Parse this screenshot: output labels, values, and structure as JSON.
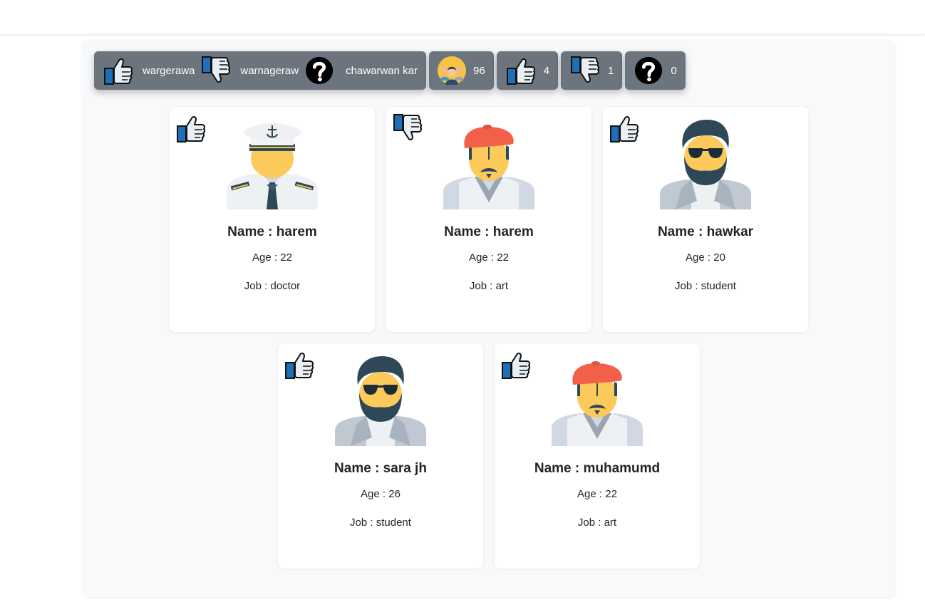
{
  "toolbar": {
    "legend": {
      "like_label": "wargerawa",
      "dislike_label": "warnageraw",
      "unknown_label": "chawarwan kar"
    },
    "counters": {
      "total": "96",
      "likes": "4",
      "dislikes": "1",
      "unknown": "0"
    }
  },
  "cards": [
    {
      "name": "Name : harem",
      "age": "Age : 22",
      "job": "Job : doctor",
      "vote": "thumbs-up",
      "avatar": "captain"
    },
    {
      "name": "Name : harem",
      "age": "Age : 22",
      "job": "Job : art",
      "vote": "thumbs-down",
      "avatar": "beret"
    },
    {
      "name": "Name : hawkar",
      "age": "Age : 20",
      "job": "Job : student",
      "vote": "thumbs-up",
      "avatar": "hipster"
    },
    {
      "name": "Name : sara jh",
      "age": "Age : 26",
      "job": "Job : student",
      "vote": "thumbs-up",
      "avatar": "hipster"
    },
    {
      "name": "Name : muhamumd",
      "age": "Age : 22",
      "job": "Job : art",
      "vote": "thumbs-up",
      "avatar": "beret"
    }
  ],
  "colors": {
    "toolbar_bg": "#6c757d",
    "panel_bg": "#f8f9fa",
    "thumb_blue": "#1e6fb8",
    "skin": "#fcc95b",
    "beret": "#f2604a",
    "hair": "#2f4858"
  }
}
